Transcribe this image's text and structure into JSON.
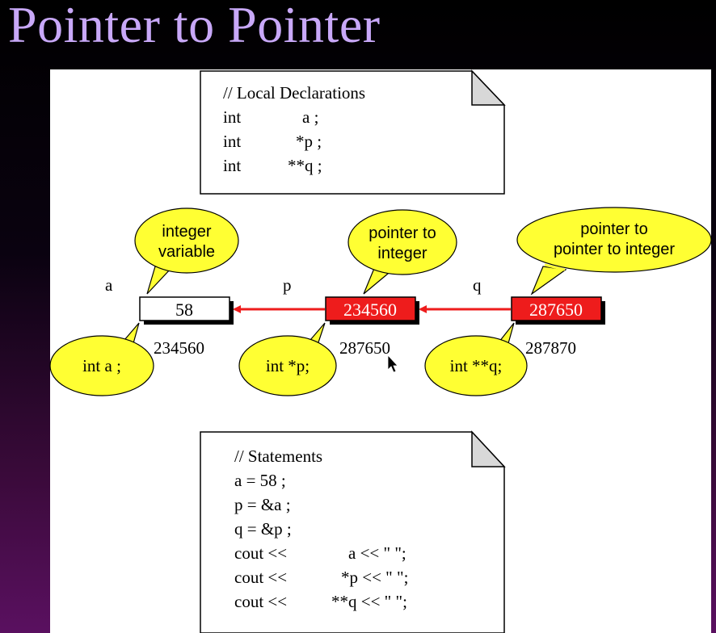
{
  "title": "Pointer to Pointer",
  "declarations": {
    "comment": "//  Local Declarations",
    "lines": [
      {
        "type": "int",
        "name": "a ;"
      },
      {
        "type": "int",
        "name": "*p ;"
      },
      {
        "type": "int",
        "name": "**q ;"
      }
    ]
  },
  "variables": [
    {
      "name": "a",
      "value": "58",
      "address": "234560",
      "callout": "integer variable",
      "callout_lines": [
        "integer",
        "variable"
      ],
      "decl": "int  a ;",
      "fill": "#ffffff"
    },
    {
      "name": "p",
      "value": "234560",
      "address": "287650",
      "callout": "pointer to integer",
      "callout_lines": [
        "pointer to",
        "integer"
      ],
      "decl": "int  *p;",
      "fill": "#ee1c1c"
    },
    {
      "name": "q",
      "value": "287650",
      "address": "287870",
      "callout": "pointer to pointer to integer",
      "callout_lines": [
        "pointer to",
        "pointer to integer"
      ],
      "decl": "int  **q;",
      "fill": "#ee1c1c"
    }
  ],
  "statements": {
    "comment": "//  Statements",
    "lines": [
      "a = 58 ;",
      "p = &a ;",
      "q = &p ;"
    ],
    "cout_lines": [
      {
        "prefix": "cout <<",
        "expr": "a << \" \";"
      },
      {
        "prefix": "cout <<",
        "expr": "*p << \" \";"
      },
      {
        "prefix": "cout <<",
        "expr": "**q << \" \";"
      }
    ]
  },
  "colors": {
    "bubble": "#ffff33",
    "pointer_box": "#ee1c1c",
    "arrow": "#ee1c1c",
    "title": "#c8a8f8"
  }
}
